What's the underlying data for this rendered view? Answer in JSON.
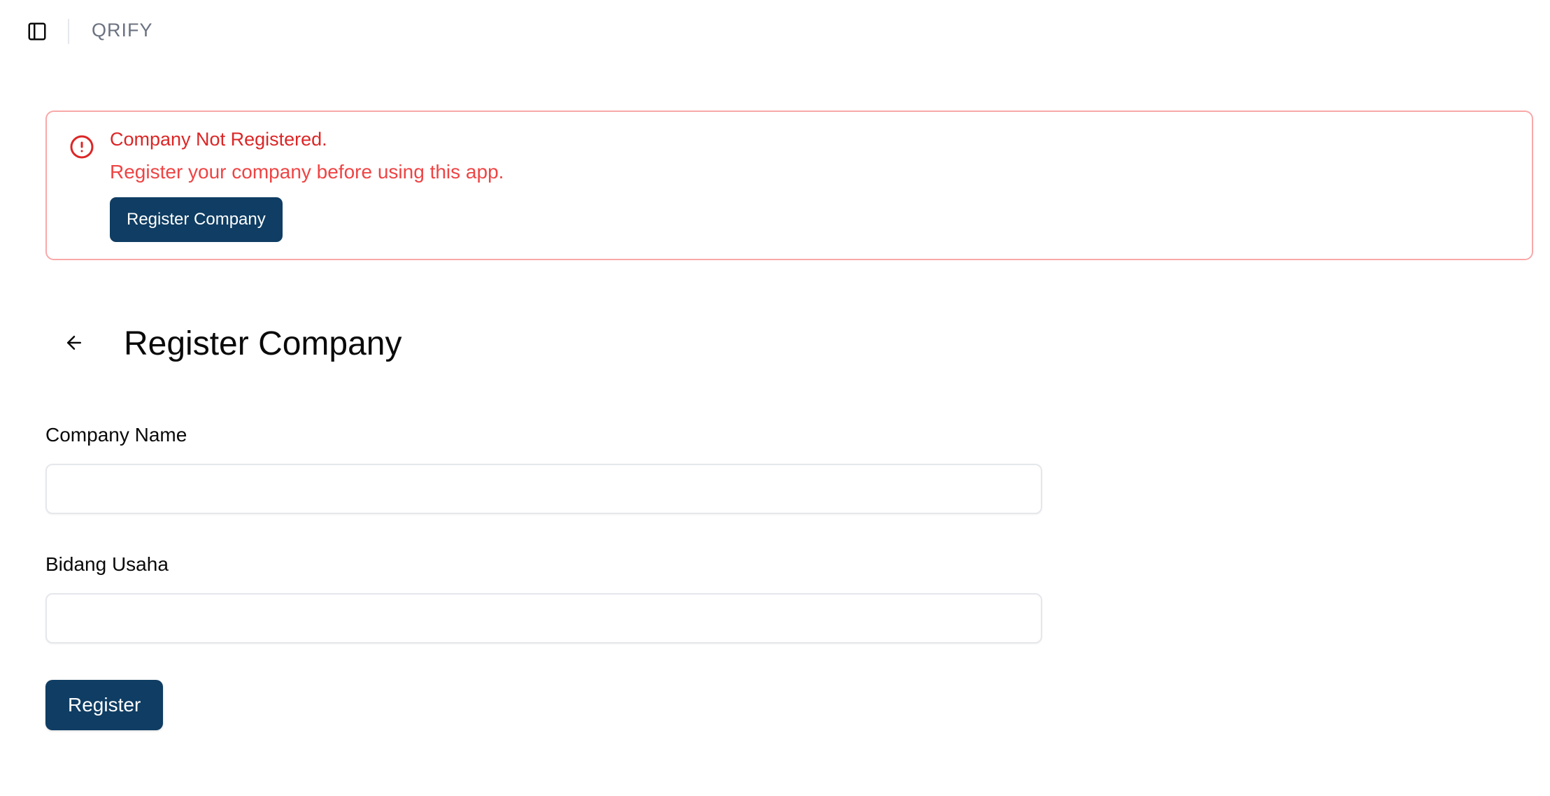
{
  "topbar": {
    "app_title": "QRIFY",
    "sidebar_toggle_icon": "sidebar-panel-icon"
  },
  "alert": {
    "icon": "alert-circle-icon",
    "title": "Company Not Registered.",
    "description": "Register your company before using this app.",
    "button_label": "Register Company",
    "color": "#dc2626",
    "border_color": "#f9a8a8"
  },
  "header": {
    "back_icon": "arrow-left-icon",
    "title": "Register Company"
  },
  "form": {
    "company_name": {
      "label": "Company Name",
      "value": "",
      "placeholder": ""
    },
    "bidang_usaha": {
      "label": "Bidang Usaha",
      "value": "",
      "placeholder": ""
    },
    "submit_label": "Register"
  },
  "colors": {
    "primary": "#0f3d63",
    "muted_text": "#6b7280"
  }
}
